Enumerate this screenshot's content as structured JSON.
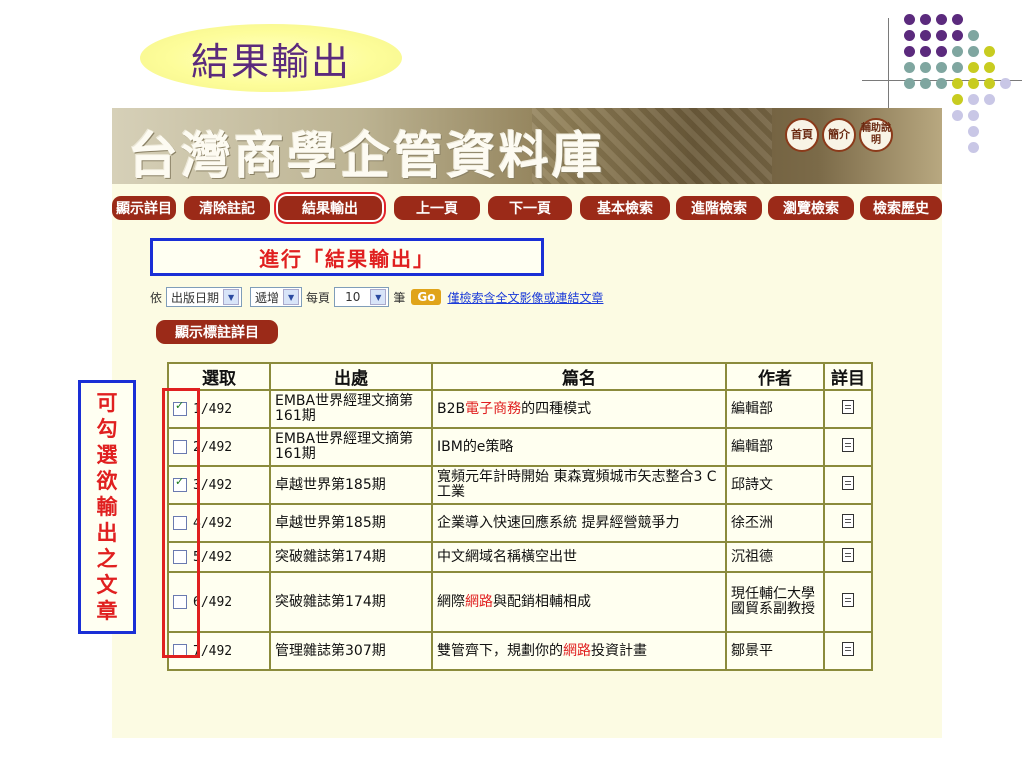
{
  "slide_title": "結果輸出",
  "colors": {
    "purple": "#5b2a7d",
    "teal": "#7fa6a0",
    "lime": "#c8cc20",
    "lavender": "#c9c7e6",
    "nav_red": "#9b2a18",
    "callout_blue": "#1a2fd6",
    "accent_red": "#e02020"
  },
  "banner": {
    "title": "台灣商學企管資料庫",
    "buttons": [
      {
        "label": "首頁"
      },
      {
        "label": "簡介"
      },
      {
        "label": "輔助說明"
      }
    ]
  },
  "nav": [
    {
      "label": "顯示詳目"
    },
    {
      "label": "清除註記"
    },
    {
      "label": "結果輸出",
      "highlighted": true
    },
    {
      "label": "上一頁"
    },
    {
      "label": "下一頁"
    },
    {
      "label": "基本檢索"
    },
    {
      "label": "進階檢索"
    },
    {
      "label": "瀏覽檢索"
    },
    {
      "label": "檢索歷史"
    }
  ],
  "callout_top": "進行「結果輸出」",
  "callout_left": [
    "可",
    "勾",
    "選",
    "欲",
    "輸",
    "出",
    "之",
    "文",
    "章"
  ],
  "sortbar": {
    "prefix": "依",
    "sort_field": "出版日期",
    "order": "遞增",
    "per_page_label": "每頁",
    "per_page": "10",
    "unit": "筆",
    "go": "Go",
    "fulltext_link": "僅檢索含全文影像或連結文章"
  },
  "annotation_button": "顯示標註詳目",
  "table": {
    "headers": [
      "選取",
      "出處",
      "篇名",
      "作者",
      "詳目"
    ],
    "rows": [
      {
        "checked": true,
        "index": "1/492",
        "source": "EMBA世界經理文摘第161期",
        "title_parts": [
          {
            "t": "B2B"
          },
          {
            "t": "電子商務",
            "hl": true
          },
          {
            "t": "的四種模式"
          }
        ],
        "author": "編輯部"
      },
      {
        "checked": false,
        "index": "2/492",
        "source": "EMBA世界經理文摘第161期",
        "title_parts": [
          {
            "t": "IBM的e策略"
          }
        ],
        "author": "編輯部"
      },
      {
        "checked": true,
        "index": "3/492",
        "source": "卓越世界第185期",
        "title_parts": [
          {
            "t": "寬頻元年計時開始 東森寬頻城市矢志整合3 C工業"
          }
        ],
        "author": "邱詩文"
      },
      {
        "checked": false,
        "index": "4/492",
        "source": "卓越世界第185期",
        "title_parts": [
          {
            "t": "企業導入快速回應系統 提昇經營競爭力"
          }
        ],
        "author": "徐丕洲"
      },
      {
        "checked": false,
        "index": "5/492",
        "source": "突破雜誌第174期",
        "title_parts": [
          {
            "t": "中文網域名稱橫空出世"
          }
        ],
        "author": "沉祖德"
      },
      {
        "checked": false,
        "index": "6/492",
        "source": "突破雜誌第174期",
        "title_parts": [
          {
            "t": "網際"
          },
          {
            "t": "網路",
            "hl": true
          },
          {
            "t": "與配銷相輔相成"
          }
        ],
        "author": "現任輔仁大學國貿系副教授"
      },
      {
        "checked": false,
        "index": "7/492",
        "source": "管理雜誌第307期",
        "title_parts": [
          {
            "t": "雙管齊下，規劃你的"
          },
          {
            "t": "網路",
            "hl": true
          },
          {
            "t": "投資計畫"
          }
        ],
        "author": "鄒景平"
      }
    ]
  }
}
